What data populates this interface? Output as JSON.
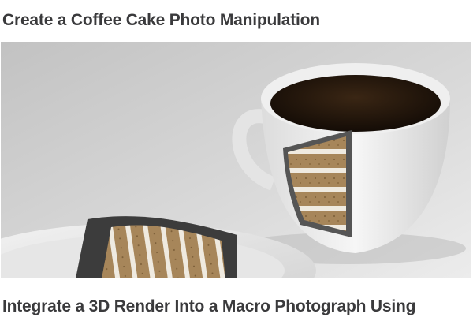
{
  "articles": [
    {
      "title": "Create a Coffee Cake Photo Manipulation"
    },
    {
      "title": "Integrate a 3D Render Into a Macro Photograph Using"
    }
  ],
  "colors": {
    "title": "#3a3a3c",
    "background": "#ffffff"
  }
}
